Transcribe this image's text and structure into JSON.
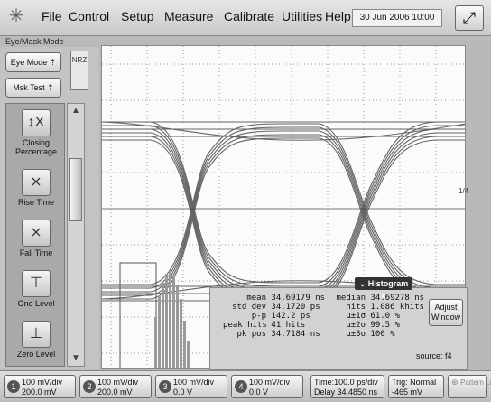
{
  "menu": {
    "logo_icon": "starburst-icon",
    "items": [
      "File",
      "Control",
      "Setup",
      "Measure",
      "Calibrate",
      "Utilities",
      "Help"
    ],
    "datetime": "30 Jun 2006  10:00",
    "window_button_icon": "resize-window-icon"
  },
  "mode_label": "Eye/Mask Mode",
  "left": {
    "eye_mode": "Eye Mode",
    "mask_test": "Msk Test",
    "nrz": "NRZ",
    "tools": [
      {
        "label": "Closing Percentage",
        "icon": "closing-percentage-icon"
      },
      {
        "label": "Rise Time",
        "icon": "rise-time-icon"
      },
      {
        "label": "Fall Time",
        "icon": "fall-time-icon"
      },
      {
        "label": "One Level",
        "icon": "one-level-icon"
      },
      {
        "label": "Zero Level",
        "icon": "zero-level-icon"
      }
    ]
  },
  "screen": {
    "right_marker": "1/4"
  },
  "histogram": {
    "title": "Histogram",
    "stats_left": [
      {
        "label": "mean",
        "value": "34.69179 ns"
      },
      {
        "label": "std dev",
        "value": "34.1720 ps"
      },
      {
        "label": "p-p",
        "value": "142.2 ps"
      },
      {
        "label": "peak hits",
        "value": "41 hits"
      },
      {
        "label": "pk pos",
        "value": "34.7184 ns"
      }
    ],
    "stats_right": [
      {
        "label": "median",
        "value": "34.69278 ns"
      },
      {
        "label": "hits",
        "value": "1.086 khits"
      },
      {
        "label": "μ±1σ",
        "value": "61.0 %"
      },
      {
        "label": "μ±2σ",
        "value": "99.5 %"
      },
      {
        "label": "μ±3σ",
        "value": "100 %"
      }
    ],
    "adjust_window": "Adjust Window",
    "source": "source: f4"
  },
  "bottom": {
    "channels": [
      {
        "num": "1",
        "line1": "100 mV/div",
        "line2": "200.0 mV"
      },
      {
        "num": "2",
        "line1": "100 mV/div",
        "line2": "200.0 mV"
      },
      {
        "num": "3",
        "line1": "100 mV/div",
        "line2": "0.0 V"
      },
      {
        "num": "4",
        "line1": "100 mV/div",
        "line2": "0.0 V"
      }
    ],
    "time_line1": "Time:100.0 ps/div",
    "time_line2": "Delay 34.4850 ns",
    "trig_line1": "Trig: Normal",
    "trig_line2": "-465 mV",
    "pattern_lock": "Pattern Lock"
  },
  "colors": {
    "background": "#b9b9b9",
    "screen": "#fbfbfb",
    "trace": "#4a4a4a",
    "histogram_bars": "#9a9a9a"
  }
}
